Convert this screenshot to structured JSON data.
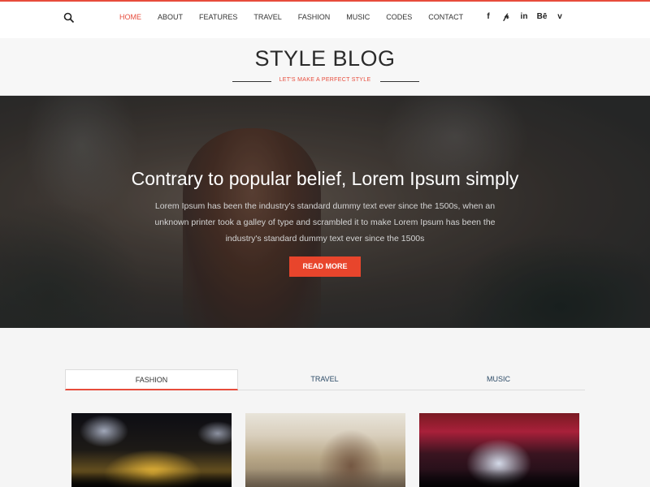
{
  "nav": {
    "search_icon": "search-icon",
    "items": [
      {
        "label": "HOME",
        "active": true
      },
      {
        "label": "ABOUT"
      },
      {
        "label": "FEATURES"
      },
      {
        "label": "TRAVEL"
      },
      {
        "label": "FASHION"
      },
      {
        "label": "MUSIC"
      },
      {
        "label": "CODES"
      },
      {
        "label": "CONTACT"
      }
    ],
    "social": [
      {
        "icon": "facebook-icon",
        "glyph": "f"
      },
      {
        "icon": "pinterest-icon",
        "glyph": "𝓅"
      },
      {
        "icon": "linkedin-icon",
        "glyph": "in"
      },
      {
        "icon": "behance-icon",
        "glyph": "Bē"
      },
      {
        "icon": "vimeo-icon",
        "glyph": "v"
      }
    ]
  },
  "header": {
    "title": "STYLE BLOG",
    "tagline": "LET'S MAKE A PERFECT STYLE"
  },
  "hero": {
    "title": "Contrary to popular belief, Lorem Ipsum simply",
    "text": "Lorem Ipsum has been the industry's standard dummy text ever since the 1500s, when an unknown printer took a galley of type and scrambled it to make Lorem Ipsum has been the industry's standard dummy text ever since the 1500s",
    "button": "READ MORE"
  },
  "tabs": [
    {
      "label": "FASHION",
      "active": true
    },
    {
      "label": "TRAVEL"
    },
    {
      "label": "MUSIC"
    }
  ],
  "colors": {
    "accent": "#e74c3c",
    "button": "#e8452c",
    "tab_text": "#2c4a66"
  }
}
